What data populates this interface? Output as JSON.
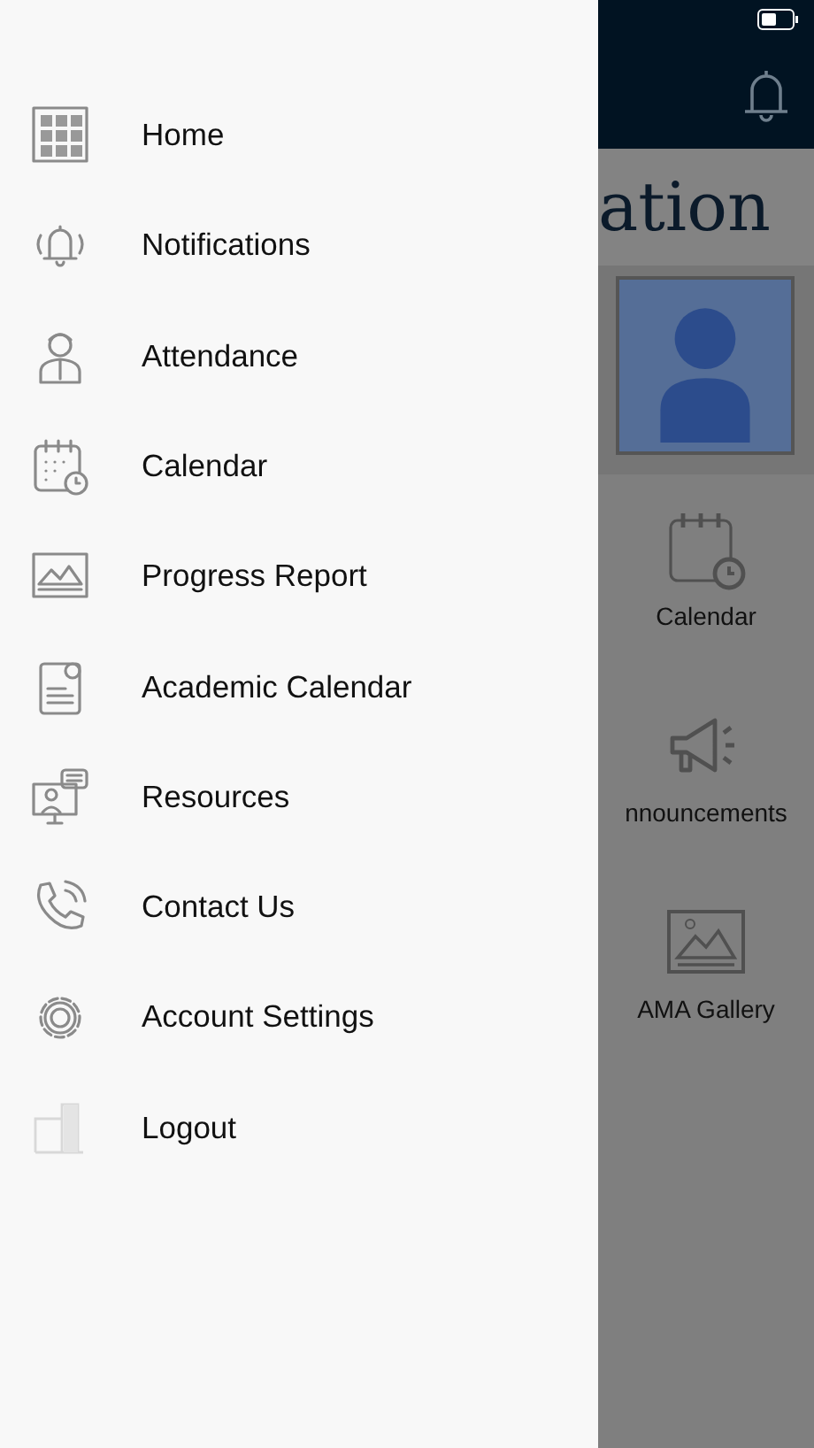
{
  "drawer": {
    "items": [
      {
        "label": "Home"
      },
      {
        "label": "Notifications"
      },
      {
        "label": "Attendance"
      },
      {
        "label": "Calendar"
      },
      {
        "label": "Progress Report"
      },
      {
        "label": "Academic Calendar"
      },
      {
        "label": "Resources"
      },
      {
        "label": "Contact Us"
      },
      {
        "label": "Account Settings"
      },
      {
        "label": "Logout"
      }
    ]
  },
  "background_screen": {
    "title": "ation",
    "tiles": [
      {
        "label": "Calendar"
      },
      {
        "label": "nnouncements"
      },
      {
        "label": "AMA Gallery"
      }
    ]
  }
}
